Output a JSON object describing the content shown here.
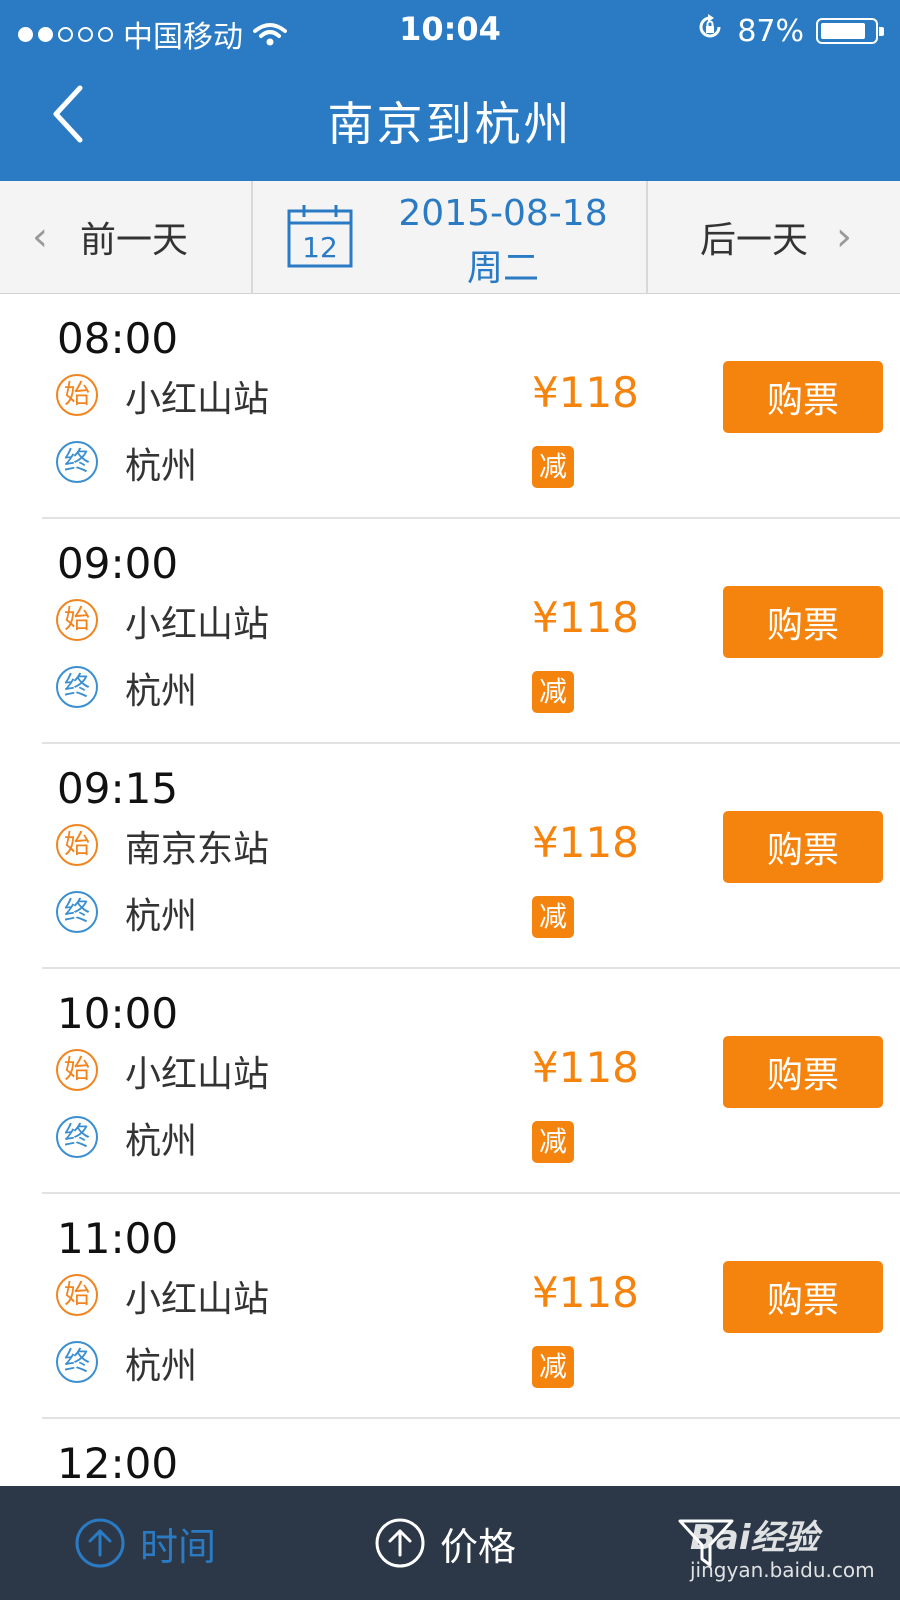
{
  "status_bar": {
    "carrier": "中国移动",
    "time": "10:04",
    "battery_percent": "87%",
    "battery_level": 0.87,
    "signal_bars": 2,
    "signal_total": 5
  },
  "nav": {
    "title": "南京到杭州",
    "back_icon": "chevron-left-icon"
  },
  "date_bar": {
    "prev_label": "前一天",
    "calendar_day": "12",
    "date": "2015-08-18",
    "weekday": "周二",
    "next_label": "后一天"
  },
  "trips": [
    {
      "time": "08:00",
      "start_badge": "始",
      "from": "小红山站",
      "end_badge": "终",
      "to": "杭州",
      "price": "¥118",
      "discount": "减",
      "buy_label": "购票"
    },
    {
      "time": "09:00",
      "start_badge": "始",
      "from": "小红山站",
      "end_badge": "终",
      "to": "杭州",
      "price": "¥118",
      "discount": "减",
      "buy_label": "购票"
    },
    {
      "time": "09:15",
      "start_badge": "始",
      "from": "南京东站",
      "end_badge": "终",
      "to": "杭州",
      "price": "¥118",
      "discount": "减",
      "buy_label": "购票"
    },
    {
      "time": "10:00",
      "start_badge": "始",
      "from": "小红山站",
      "end_badge": "终",
      "to": "杭州",
      "price": "¥118",
      "discount": "减",
      "buy_label": "购票"
    },
    {
      "time": "11:00",
      "start_badge": "始",
      "from": "小红山站",
      "end_badge": "终",
      "to": "杭州",
      "price": "¥118",
      "discount": "减",
      "buy_label": "购票"
    },
    {
      "time": "12:00"
    }
  ],
  "bottom_bar": {
    "sort_time_label": "时间",
    "sort_price_label": "价格",
    "filter_icon": "filter-icon",
    "active_color": "#2a7bc4"
  },
  "watermark": {
    "brand": "Bai经验",
    "url": "jingyan.baidu.com"
  },
  "colors": {
    "primary": "#2a7bc4",
    "accent": "#f5840e",
    "bottom_bar": "#2c3847"
  }
}
